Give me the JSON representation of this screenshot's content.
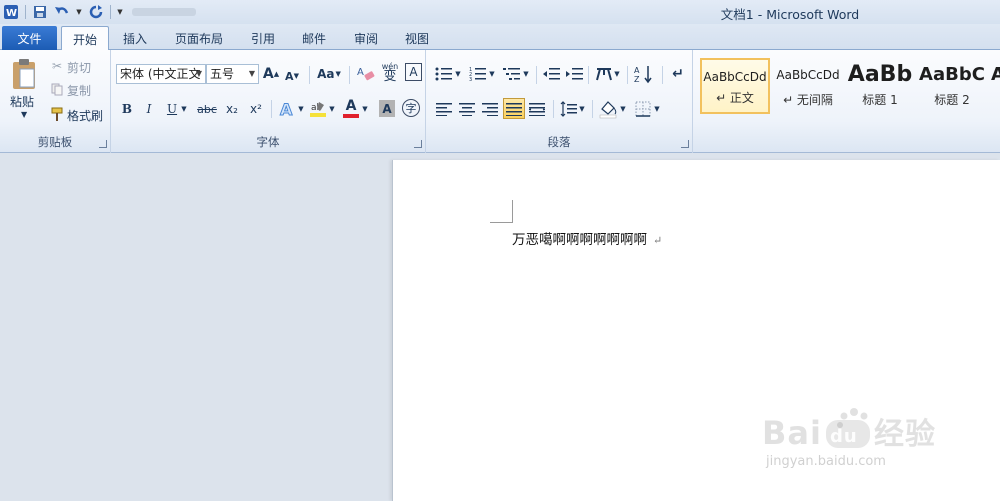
{
  "window": {
    "title": "文档1  -  Microsoft Word"
  },
  "qat": {
    "items": [
      {
        "name": "word-logo-icon"
      },
      {
        "name": "save-icon"
      },
      {
        "name": "undo-icon"
      },
      {
        "name": "redo-icon"
      }
    ]
  },
  "tabs": {
    "file": "文件",
    "items": [
      "开始",
      "插入",
      "页面布局",
      "引用",
      "邮件",
      "审阅",
      "视图"
    ],
    "active": "开始"
  },
  "clipboard": {
    "group_label": "剪贴板",
    "paste": "粘贴",
    "cut": "剪切",
    "copy": "复制",
    "format_painter": "格式刷"
  },
  "font": {
    "group_label": "字体",
    "font_name": "宋体 (中文正文",
    "font_size": "五号",
    "grow": "A",
    "shrink": "A",
    "change_case": "Aa",
    "bold": "B",
    "italic": "I",
    "underline": "U",
    "strikethrough": "abc",
    "subscript": "x₂",
    "superscript": "x²",
    "font_color": "A",
    "char_shading": "A",
    "phonetic": "wén",
    "phonetic_char": "变",
    "char_border": "A",
    "enclose_char": "字"
  },
  "paragraph": {
    "group_label": "段落"
  },
  "styles": {
    "items": [
      {
        "sample": "AaBbCcDd",
        "name": "↵ 正文",
        "selected": true
      },
      {
        "sample": "AaBbCcDd",
        "name": "↵ 无间隔",
        "selected": false
      },
      {
        "sample": "AaBb",
        "name": "标题 1",
        "selected": false
      },
      {
        "sample": "AaBbC",
        "name": "标题 2",
        "selected": false
      }
    ]
  },
  "document": {
    "text": "万恶噶啊啊啊啊啊啊啊",
    "para_mark": "↵"
  },
  "watermark": {
    "logo": "Bai du 经验",
    "url": "jingyan.baidu.com"
  },
  "colors": {
    "file_tab": "#2a6cc8",
    "highlight": "#f5e13a",
    "font_red": "#e0202c",
    "style_selected": "#f2c15d"
  }
}
